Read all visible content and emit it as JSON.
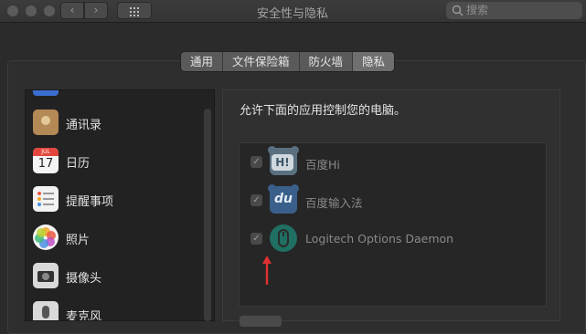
{
  "window": {
    "title": "安全性与隐私"
  },
  "toolbar": {
    "back_label": "‹",
    "forward_label": "›",
    "search_placeholder": "搜索"
  },
  "tabs": [
    {
      "label": "通用",
      "active": false
    },
    {
      "label": "文件保险箱",
      "active": false
    },
    {
      "label": "防火墙",
      "active": false
    },
    {
      "label": "隐私",
      "active": true
    }
  ],
  "sidebar": {
    "items": [
      {
        "label": "通讯录",
        "icon": "contacts-icon"
      },
      {
        "label": "日历",
        "icon": "calendar-icon",
        "icon_month": "JUL",
        "icon_day": "17"
      },
      {
        "label": "提醒事项",
        "icon": "reminders-icon"
      },
      {
        "label": "照片",
        "icon": "photos-icon"
      },
      {
        "label": "摄像头",
        "icon": "camera-icon"
      },
      {
        "label": "麦克风",
        "icon": "microphone-icon"
      }
    ]
  },
  "main": {
    "heading": "允许下面的应用控制您的电脑。",
    "apps": [
      {
        "name": "百度Hi",
        "checked": true,
        "icon": "baidu-hi-icon",
        "icon_text": "H!"
      },
      {
        "name": "百度输入法",
        "checked": true,
        "icon": "baidu-input-icon",
        "icon_text": "du"
      },
      {
        "name": "Logitech Options Daemon",
        "checked": true,
        "icon": "logitech-mouse-icon"
      }
    ]
  },
  "colors": {
    "window_bg": "#2b2b2b",
    "annotation_arrow": "#e03030"
  }
}
